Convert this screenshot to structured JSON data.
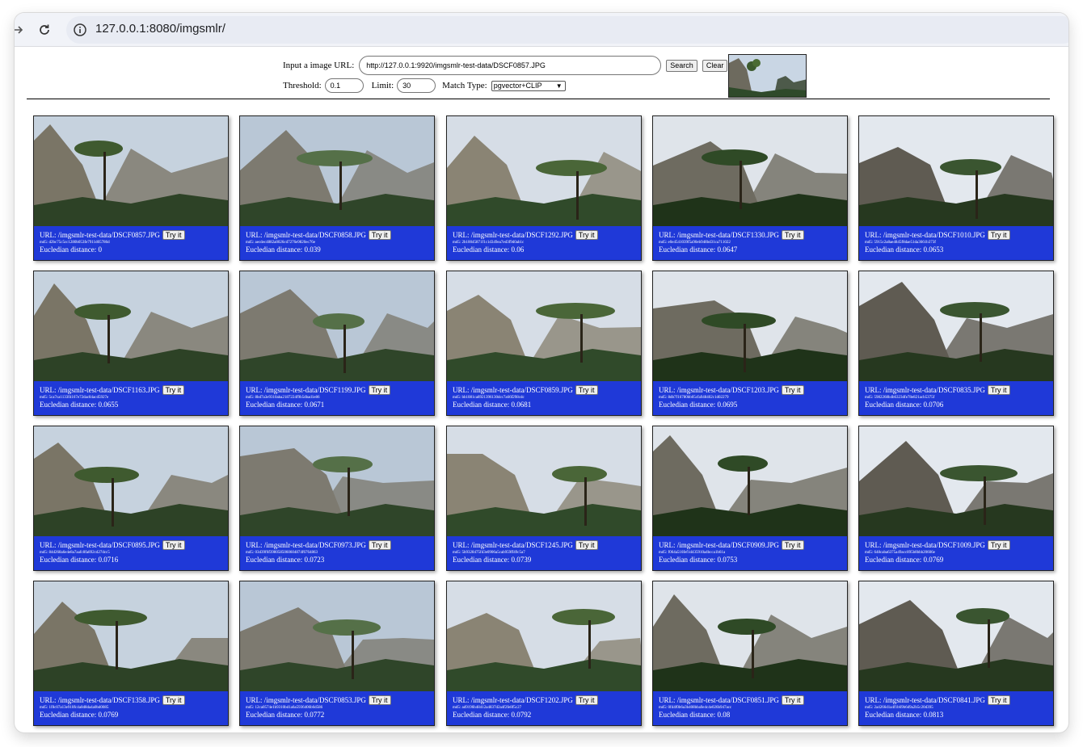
{
  "browser": {
    "url": "127.0.0.1:8080/imgsmlr/"
  },
  "form": {
    "url_label": "Input a image URL:",
    "url_value": "http://127.0.0.1:9920/imgsmlr-test-data/DSCF0857.JPG",
    "search_label": "Search",
    "clear_label": "Clear",
    "threshold_label": "Threshold:",
    "threshold_value": "0.1",
    "limit_label": "Limit:",
    "limit_value": "30",
    "match_type_label": "Match Type:",
    "match_type_value": "pgvector+CLIP"
  },
  "results": [
    {
      "url": "URL: /imgsmlr-test-data/DSCF0857.JPG",
      "md5": "md5: d2bc75c5cc1280b053fe7911d05786d",
      "distance": "Eucledian distance: 0",
      "try_label": "Try it"
    },
    {
      "url": "URL: /imgsmlr-test-data/DSCF0858.JPG",
      "md5": "md5: aecdec4882a8026cd7276e9820ec76e",
      "distance": "Eucledian distance: 0.039",
      "try_label": "Try it"
    },
    {
      "url": "URL: /imgsmlr-test-data/DSCF1292.JPG",
      "md5": "md5: 2b10045871f1c1d349ea7ed3f9d0ab1c",
      "distance": "Eucledian distance: 0.06",
      "try_label": "Try it"
    },
    {
      "url": "URL: /imgsmlr-test-data/DSCF1330.JPG",
      "md5": "md5: e0e4541039f5a90eb948bd31ca711022",
      "distance": "Eucledian distance: 0.0647",
      "try_label": "Try it"
    },
    {
      "url": "URL: /imgsmlr-test-data/DSCF1010.JPG",
      "md5": "md5: 5915c2a8ae4845f8dae51da3661b373f",
      "distance": "Eucledian distance: 0.0653",
      "try_label": "Try it"
    },
    {
      "url": "URL: /imgsmlr-test-data/DSCF1163.JPG",
      "md5": "md5: 5ca7ca1133f4167e72dac84acd5927e",
      "distance": "Eucledian distance: 0.0655",
      "try_label": "Try it"
    },
    {
      "url": "URL: /imgsmlr-test-data/DSCF1199.JPG",
      "md5": "md5: 8bd7a3e9310aba2187224f9b5dbad1e86",
      "distance": "Eucledian distance: 0.0671",
      "try_label": "Try it"
    },
    {
      "url": "URL: /imgsmlr-test-data/DSCF0859.JPG",
      "md5": "md5: bb1081ca8921396130dcc7a66f298cdc",
      "distance": "Eucledian distance: 0.0681",
      "try_label": "Try it"
    },
    {
      "url": "URL: /imgsmlr-test-data/DSCF1203.JPG",
      "md5": "md5: 8db7f16780bb05cfa948402c1d02279",
      "distance": "Eucledian distance: 0.0695",
      "try_label": "Try it"
    },
    {
      "url": "URL: /imgsmlr-test-data/DSCF0835.JPG",
      "md5": "md5: 5982268b4b6323dfe78e821acb5375f",
      "distance": "Eucledian distance: 0.0706",
      "try_label": "Try it"
    },
    {
      "url": "URL: /imgsmlr-test-data/DSCF0895.JPG",
      "md5": "md5: 84d268a6e4e8a7aafc8fa892cd27dcc5",
      "distance": "Eucledian distance: 0.0716",
      "try_label": "Try it"
    },
    {
      "url": "URL: /imgsmlr-test-data/DSCF0973.JPG",
      "md5": "md5: 03d39f6f3980585060604874f6764863",
      "distance": "Eucledian distance: 0.0723",
      "try_label": "Try it"
    },
    {
      "url": "URL: /imgsmlr-test-data/DSCF1245.JPG",
      "md5": "md5: 5b9328475fd3e0906a5cab959ff49c5a7",
      "distance": "Eucledian distance: 0.0739",
      "try_label": "Try it"
    },
    {
      "url": "URL: /imgsmlr-test-data/DSCF0909.JPG",
      "md5": "md5: f064a516fef1d435910a4bcca1b61a",
      "distance": "Eucledian distance: 0.0753",
      "try_label": "Try it"
    },
    {
      "url": "URL: /imgsmlr-test-data/DSCF1009.JPG",
      "md5": "md5: 648caba6375a49acc895b8bbb20606e",
      "distance": "Eucledian distance: 0.0769",
      "try_label": "Try it"
    },
    {
      "url": "URL: /imgsmlr-test-data/DSCF1358.JPG",
      "md5": "md5: 1f8c07a13e910fc4a0d8da4a0bd0085",
      "distance": "Eucledian distance: 0.0769",
      "try_label": "Try it"
    },
    {
      "url": "URL: /imgsmlr-test-data/DSCF0853.JPG",
      "md5": "md5: 12ca0574e1b9310bd1a6a5936406b6d586",
      "distance": "Eucledian distance: 0.0772",
      "try_label": "Try it"
    },
    {
      "url": "URL: /imgsmlr-test-data/DSCF1202.JPG",
      "md5": "md5: ad9196b48412a4837d2a4f2fe8f5c27",
      "distance": "Eucledian distance: 0.0792",
      "try_label": "Try it"
    },
    {
      "url": "URL: /imgsmlr-test-data/DSCF0851.JPG",
      "md5": "md5: 0fd4f0b6a3b408bba9e4c4e026b947acc",
      "distance": "Eucledian distance: 0.08",
      "try_label": "Try it"
    },
    {
      "url": "URL: /imgsmlr-test-data/DSCF0841.JPG",
      "md5": "md5: 2a4266d1a4f1b69b6d9a2b5c20d395",
      "distance": "Eucledian distance: 0.0813",
      "try_label": "Try it"
    }
  ],
  "icons": {
    "forward": "forward-icon",
    "reload": "reload-icon",
    "info": "info-icon",
    "select_chevron": "chevron-down-icon"
  },
  "colors": {
    "card_background": "#1f39d8",
    "toolbar_background": "#f1f3f8"
  }
}
